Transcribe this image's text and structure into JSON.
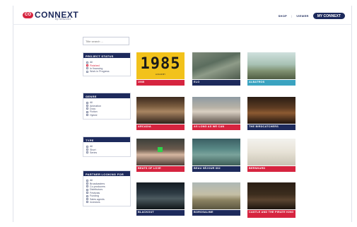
{
  "header": {
    "logo_badge": "CO",
    "logo_text": "CONNEXT",
    "logo_sub": "by Network1",
    "nav": [
      "SHOP",
      "VIEWER"
    ],
    "nav_sep": "|",
    "my_button": "MY CONNEXT"
  },
  "search": {
    "placeholder": "Title search ..."
  },
  "filters": [
    {
      "title": "PROJECT STATUS",
      "options": [
        {
          "label": "All",
          "selected": false
        },
        {
          "label": "Finished",
          "selected": true
        },
        {
          "label": "In financing",
          "selected": false
        },
        {
          "label": "Work in Progress",
          "selected": false
        }
      ]
    },
    {
      "title": "GENRE",
      "options": [
        {
          "label": "All",
          "selected": false
        },
        {
          "label": "Animation",
          "selected": false
        },
        {
          "label": "Docu",
          "selected": false
        },
        {
          "label": "Fiction",
          "selected": false
        },
        {
          "label": "Hybrid",
          "selected": false
        }
      ]
    },
    {
      "title": "TYPE",
      "options": [
        {
          "label": "All",
          "selected": false
        },
        {
          "label": "Short",
          "selected": false
        },
        {
          "label": "Series",
          "selected": false
        }
      ]
    },
    {
      "title": "PARTNER LOOKING FOR",
      "options": [
        {
          "label": "All",
          "selected": false
        },
        {
          "label": "Broadcasters",
          "selected": false
        },
        {
          "label": "Co-producers",
          "selected": false
        },
        {
          "label": "Distributors",
          "selected": false
        },
        {
          "label": "Festivals",
          "selected": false
        },
        {
          "label": "Funding",
          "selected": false
        },
        {
          "label": "Sales agents",
          "selected": false
        },
        {
          "label": "Investors",
          "selected": false
        }
      ]
    }
  ],
  "films": [
    {
      "title": "1985",
      "color": "#d6243f",
      "thumb": "yellow",
      "poster_text": "1985",
      "poster_sub": "A FILM BY"
    },
    {
      "title": "ELO",
      "color": "#1d2a5c",
      "thumb": "aerial"
    },
    {
      "title": "ALBATROS",
      "color": "#3aa3c0",
      "thumb": "group"
    },
    {
      "title": "ARCADIA",
      "color": "#d6243f",
      "thumb": "interior"
    },
    {
      "title": "AS LONG AS WE CAN",
      "color": "#d6243f",
      "thumb": "portrait"
    },
    {
      "title": "THE BIRDCATCHERS",
      "color": "#1d2a5c",
      "thumb": "dark"
    },
    {
      "title": "BEATS OF LOVE",
      "color": "#d6243f",
      "thumb": "beats"
    },
    {
      "title": "BEAU SÉJOUR 602",
      "color": "#1d2a5c",
      "thumb": "swim"
    },
    {
      "title": "BERNHARD",
      "color": "#d6243f",
      "thumb": "bright"
    },
    {
      "title": "BLACKOUT",
      "color": "#1d2a5c",
      "thumb": "night"
    },
    {
      "title": "BOROSALIME",
      "color": "#1d2a5c",
      "thumb": "field"
    },
    {
      "title": "CASTLE AND THE PIRATE KING",
      "color": "#d6243f",
      "thumb": "darkred"
    }
  ]
}
